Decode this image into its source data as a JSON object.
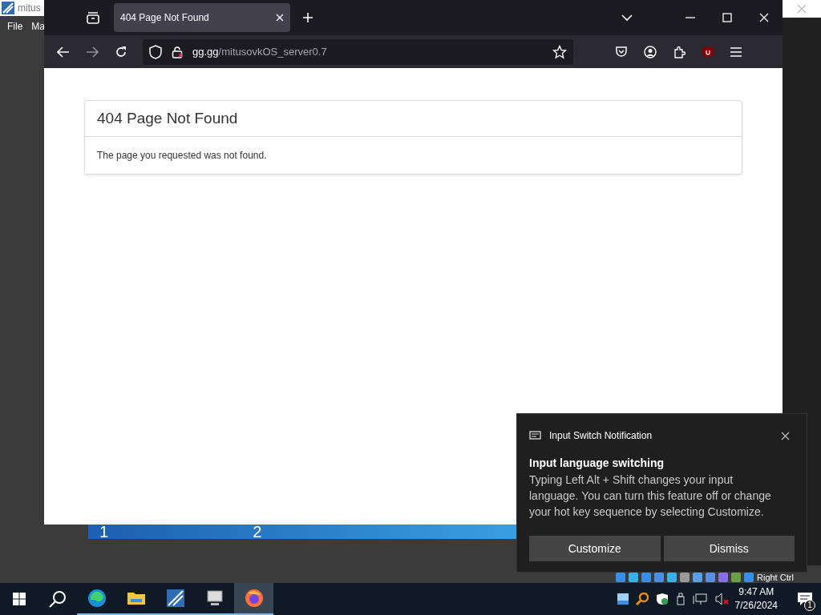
{
  "background_window": {
    "title": "mitus",
    "menu": [
      "File",
      "Ma"
    ]
  },
  "behind_bar": {
    "labels": [
      "1",
      "2"
    ]
  },
  "browser": {
    "tabs": [
      {
        "title": "404 Page Not Found",
        "selected": true
      }
    ],
    "url": {
      "domain": "gg.gg",
      "path": "/mitusovkOS_server0.7"
    },
    "page": {
      "heading": "404 Page Not Found",
      "message": "The page you requested was not found."
    }
  },
  "vm_status": {
    "label": "Right Ctrl"
  },
  "notification": {
    "app": "Input Switch Notification",
    "title": "Input language switching",
    "body": "Typing Left Alt + Shift changes your input language. You can turn this feature off or change your hot key sequence by selecting Customize.",
    "buttons": [
      "Customize",
      "Dismiss"
    ]
  },
  "taskbar": {
    "apps": [
      {
        "kind": "edge",
        "selected": false
      },
      {
        "kind": "folder",
        "selected": false
      },
      {
        "kind": "calc",
        "selected": false
      },
      {
        "kind": "computer",
        "selected": false
      },
      {
        "kind": "firefox",
        "selected": true
      }
    ],
    "time": "9:47 AM",
    "date": "7/26/2024",
    "notification_count": "1"
  }
}
